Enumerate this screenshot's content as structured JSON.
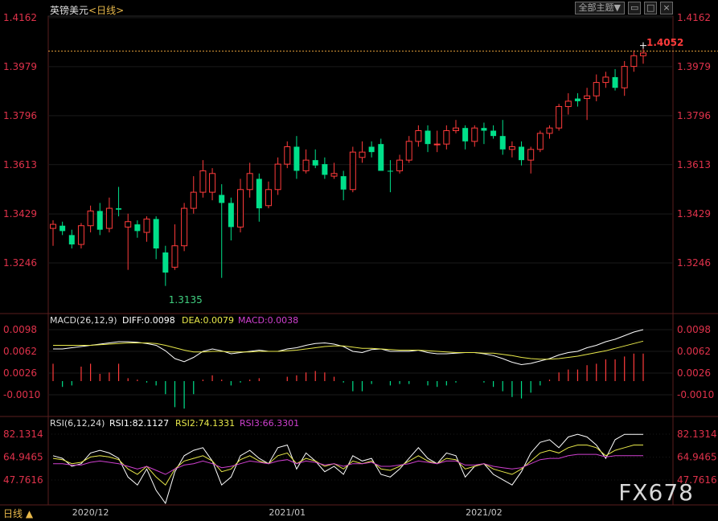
{
  "header": {
    "symbol": "英镑美元",
    "period_link": "<日线>"
  },
  "toolbar": {
    "theme_button": "全部主题▼",
    "icons": [
      "window-restore-icon",
      "window-maximize-icon",
      "close-window-icon"
    ]
  },
  "main_chart": {
    "price_ticks": [
      "1.4162",
      "1.3979",
      "1.3796",
      "1.3613",
      "1.3429",
      "1.3246"
    ],
    "price_tick_values": [
      1.4162,
      1.3979,
      1.3796,
      1.3613,
      1.3429,
      1.3246
    ],
    "last_price": "1.4052",
    "low_label": "1.3135",
    "high_label": "1.4052",
    "candles": [
      {
        "o": 1.339,
        "h": 1.3405,
        "l": 1.331,
        "c": 1.3375,
        "d": "up"
      },
      {
        "o": 1.3385,
        "h": 1.34,
        "l": 1.335,
        "c": 1.3365,
        "d": "down"
      },
      {
        "o": 1.335,
        "h": 1.337,
        "l": 1.33,
        "c": 1.3315,
        "d": "down"
      },
      {
        "o": 1.3315,
        "h": 1.3395,
        "l": 1.33,
        "c": 1.3385,
        "d": "up"
      },
      {
        "o": 1.3385,
        "h": 1.346,
        "l": 1.336,
        "c": 1.344,
        "d": "up"
      },
      {
        "o": 1.344,
        "h": 1.347,
        "l": 1.335,
        "c": 1.337,
        "d": "down"
      },
      {
        "o": 1.3375,
        "h": 1.349,
        "l": 1.336,
        "c": 1.345,
        "d": "up"
      },
      {
        "o": 1.345,
        "h": 1.353,
        "l": 1.342,
        "c": 1.3445,
        "d": "down"
      },
      {
        "o": 1.34,
        "h": 1.343,
        "l": 1.322,
        "c": 1.338,
        "d": "up"
      },
      {
        "o": 1.339,
        "h": 1.3405,
        "l": 1.334,
        "c": 1.3365,
        "d": "down"
      },
      {
        "o": 1.336,
        "h": 1.342,
        "l": 1.3325,
        "c": 1.341,
        "d": "up"
      },
      {
        "o": 1.341,
        "h": 1.342,
        "l": 1.326,
        "c": 1.33,
        "d": "down"
      },
      {
        "o": 1.3285,
        "h": 1.331,
        "l": 1.316,
        "c": 1.321,
        "d": "down"
      },
      {
        "o": 1.323,
        "h": 1.339,
        "l": 1.322,
        "c": 1.331,
        "d": "up"
      },
      {
        "o": 1.331,
        "h": 1.347,
        "l": 1.329,
        "c": 1.345,
        "d": "up"
      },
      {
        "o": 1.345,
        "h": 1.357,
        "l": 1.343,
        "c": 1.351,
        "d": "up"
      },
      {
        "o": 1.351,
        "h": 1.363,
        "l": 1.349,
        "c": 1.359,
        "d": "up"
      },
      {
        "o": 1.358,
        "h": 1.36,
        "l": 1.348,
        "c": 1.351,
        "d": "up"
      },
      {
        "o": 1.35,
        "h": 1.354,
        "l": 1.319,
        "c": 1.347,
        "d": "down"
      },
      {
        "o": 1.347,
        "h": 1.349,
        "l": 1.333,
        "c": 1.338,
        "d": "down"
      },
      {
        "o": 1.338,
        "h": 1.356,
        "l": 1.336,
        "c": 1.352,
        "d": "up"
      },
      {
        "o": 1.352,
        "h": 1.362,
        "l": 1.349,
        "c": 1.358,
        "d": "up"
      },
      {
        "o": 1.356,
        "h": 1.358,
        "l": 1.34,
        "c": 1.345,
        "d": "down"
      },
      {
        "o": 1.346,
        "h": 1.355,
        "l": 1.345,
        "c": 1.352,
        "d": "up"
      },
      {
        "o": 1.352,
        "h": 1.364,
        "l": 1.35,
        "c": 1.3615,
        "d": "up"
      },
      {
        "o": 1.3615,
        "h": 1.37,
        "l": 1.36,
        "c": 1.368,
        "d": "up"
      },
      {
        "o": 1.368,
        "h": 1.372,
        "l": 1.356,
        "c": 1.359,
        "d": "down"
      },
      {
        "o": 1.359,
        "h": 1.367,
        "l": 1.358,
        "c": 1.363,
        "d": "up"
      },
      {
        "o": 1.363,
        "h": 1.367,
        "l": 1.36,
        "c": 1.361,
        "d": "down"
      },
      {
        "o": 1.3615,
        "h": 1.364,
        "l": 1.356,
        "c": 1.3575,
        "d": "down"
      },
      {
        "o": 1.357,
        "h": 1.362,
        "l": 1.356,
        "c": 1.358,
        "d": "up"
      },
      {
        "o": 1.357,
        "h": 1.359,
        "l": 1.348,
        "c": 1.352,
        "d": "down"
      },
      {
        "o": 1.352,
        "h": 1.368,
        "l": 1.351,
        "c": 1.366,
        "d": "up"
      },
      {
        "o": 1.366,
        "h": 1.37,
        "l": 1.362,
        "c": 1.364,
        "d": "up"
      },
      {
        "o": 1.366,
        "h": 1.37,
        "l": 1.364,
        "c": 1.368,
        "d": "down"
      },
      {
        "o": 1.369,
        "h": 1.371,
        "l": 1.359,
        "c": 1.359,
        "d": "down"
      },
      {
        "o": 1.359,
        "h": 1.363,
        "l": 1.351,
        "c": 1.359,
        "d": "down"
      },
      {
        "o": 1.359,
        "h": 1.365,
        "l": 1.358,
        "c": 1.363,
        "d": "up"
      },
      {
        "o": 1.363,
        "h": 1.372,
        "l": 1.362,
        "c": 1.37,
        "d": "up"
      },
      {
        "o": 1.37,
        "h": 1.376,
        "l": 1.368,
        "c": 1.374,
        "d": "up"
      },
      {
        "o": 1.374,
        "h": 1.376,
        "l": 1.366,
        "c": 1.369,
        "d": "down"
      },
      {
        "o": 1.369,
        "h": 1.374,
        "l": 1.366,
        "c": 1.369,
        "d": "up"
      },
      {
        "o": 1.369,
        "h": 1.376,
        "l": 1.367,
        "c": 1.374,
        "d": "up"
      },
      {
        "o": 1.374,
        "h": 1.378,
        "l": 1.373,
        "c": 1.375,
        "d": "up"
      },
      {
        "o": 1.375,
        "h": 1.376,
        "l": 1.367,
        "c": 1.37,
        "d": "down"
      },
      {
        "o": 1.37,
        "h": 1.376,
        "l": 1.368,
        "c": 1.375,
        "d": "up"
      },
      {
        "o": 1.375,
        "h": 1.377,
        "l": 1.369,
        "c": 1.374,
        "d": "down"
      },
      {
        "o": 1.374,
        "h": 1.376,
        "l": 1.371,
        "c": 1.372,
        "d": "down"
      },
      {
        "o": 1.372,
        "h": 1.378,
        "l": 1.365,
        "c": 1.367,
        "d": "down"
      },
      {
        "o": 1.367,
        "h": 1.37,
        "l": 1.364,
        "c": 1.368,
        "d": "up"
      },
      {
        "o": 1.368,
        "h": 1.37,
        "l": 1.361,
        "c": 1.363,
        "d": "down"
      },
      {
        "o": 1.363,
        "h": 1.368,
        "l": 1.358,
        "c": 1.367,
        "d": "up"
      },
      {
        "o": 1.367,
        "h": 1.374,
        "l": 1.366,
        "c": 1.373,
        "d": "up"
      },
      {
        "o": 1.373,
        "h": 1.376,
        "l": 1.371,
        "c": 1.375,
        "d": "up"
      },
      {
        "o": 1.375,
        "h": 1.384,
        "l": 1.374,
        "c": 1.383,
        "d": "up"
      },
      {
        "o": 1.383,
        "h": 1.388,
        "l": 1.38,
        "c": 1.385,
        "d": "up"
      },
      {
        "o": 1.385,
        "h": 1.388,
        "l": 1.383,
        "c": 1.386,
        "d": "down"
      },
      {
        "o": 1.386,
        "h": 1.39,
        "l": 1.378,
        "c": 1.387,
        "d": "up"
      },
      {
        "o": 1.387,
        "h": 1.395,
        "l": 1.385,
        "c": 1.392,
        "d": "up"
      },
      {
        "o": 1.392,
        "h": 1.396,
        "l": 1.39,
        "c": 1.394,
        "d": "up"
      },
      {
        "o": 1.394,
        "h": 1.397,
        "l": 1.389,
        "c": 1.39,
        "d": "down"
      },
      {
        "o": 1.39,
        "h": 1.4,
        "l": 1.387,
        "c": 1.398,
        "d": "up"
      },
      {
        "o": 1.398,
        "h": 1.404,
        "l": 1.396,
        "c": 1.402,
        "d": "up"
      },
      {
        "o": 1.402,
        "h": 1.4052,
        "l": 1.399,
        "c": 1.403,
        "d": "up"
      }
    ]
  },
  "macd": {
    "label": "MACD(26,12,9)",
    "diff_label": "DIFF:0.0098",
    "dea_label": "DEA:0.0079",
    "macd_label": "MACD:0.0038",
    "ticks": [
      "0.0098",
      "0.0062",
      "0.0026",
      "-0.0010"
    ],
    "tick_values": [
      0.0098,
      0.0062,
      0.0026,
      -0.001
    ],
    "diff": [
      0.0066,
      0.0066,
      0.0068,
      0.007,
      0.0072,
      0.0074,
      0.0076,
      0.0078,
      0.0078,
      0.0077,
      0.0075,
      0.0072,
      0.0063,
      0.005,
      0.0045,
      0.0052,
      0.0062,
      0.0066,
      0.0063,
      0.0058,
      0.006,
      0.0062,
      0.0064,
      0.0062,
      0.0062,
      0.0066,
      0.0068,
      0.0072,
      0.0075,
      0.0076,
      0.0074,
      0.007,
      0.0062,
      0.006,
      0.0065,
      0.0066,
      0.0062,
      0.0062,
      0.0062,
      0.0064,
      0.006,
      0.0058,
      0.0058,
      0.0059,
      0.006,
      0.006,
      0.0058,
      0.0055,
      0.005,
      0.0044,
      0.004,
      0.0042,
      0.0046,
      0.005,
      0.0056,
      0.006,
      0.0062,
      0.0068,
      0.0072,
      0.0078,
      0.0082,
      0.0088,
      0.0094,
      0.0098
    ],
    "dea": [
      0.0072,
      0.0072,
      0.0072,
      0.0072,
      0.0072,
      0.0073,
      0.0074,
      0.0075,
      0.0076,
      0.0076,
      0.0076,
      0.0075,
      0.0072,
      0.0068,
      0.0064,
      0.0061,
      0.0061,
      0.0062,
      0.0062,
      0.0061,
      0.0061,
      0.0061,
      0.0062,
      0.0062,
      0.0062,
      0.0063,
      0.0064,
      0.0066,
      0.0068,
      0.007,
      0.0071,
      0.0071,
      0.0069,
      0.0067,
      0.0067,
      0.0066,
      0.0065,
      0.0064,
      0.0064,
      0.0064,
      0.0063,
      0.0062,
      0.0061,
      0.006,
      0.006,
      0.006,
      0.0059,
      0.0059,
      0.0057,
      0.0055,
      0.0052,
      0.005,
      0.0049,
      0.0049,
      0.005,
      0.0052,
      0.0054,
      0.0057,
      0.006,
      0.0063,
      0.0067,
      0.0071,
      0.0075,
      0.0079
    ],
    "hist": [
      0.0024,
      -0.0008,
      -0.0006,
      0.002,
      0.0024,
      0.001,
      0.0012,
      0.0024,
      0.0004,
      0.0002,
      -0.0002,
      -0.0006,
      -0.0018,
      -0.0036,
      -0.0038,
      -0.0018,
      0.0002,
      0.0008,
      0.0002,
      -0.0006,
      -0.0002,
      0.0002,
      0.0004,
      0.0,
      0.0,
      0.0006,
      0.0008,
      0.0012,
      0.0014,
      0.0012,
      0.0006,
      -0.0002,
      -0.0014,
      -0.0014,
      -0.0004,
      0.0,
      -0.0006,
      -0.0004,
      -0.0004,
      0.0,
      -0.0006,
      -0.0008,
      -0.0006,
      -0.0002,
      0.0,
      0.0,
      -0.0002,
      -0.0008,
      -0.0014,
      -0.0022,
      -0.0024,
      -0.0016,
      -0.0006,
      0.0002,
      0.0012,
      0.0016,
      0.0016,
      0.0022,
      0.0024,
      0.003,
      0.003,
      0.0034,
      0.0038,
      0.0038
    ]
  },
  "rsi": {
    "label": "RSI(6,12,24)",
    "rsi1_label": "RSI1:82.1127",
    "rsi2_label": "RSI2:74.1331",
    "rsi3_label": "RSI3:66.3301",
    "ticks": [
      "82.1314",
      "64.9465",
      "47.7616"
    ],
    "tick_values": [
      82.1314,
      64.9465,
      47.7616
    ],
    "rsi1": [
      66,
      64,
      58,
      60,
      68,
      70,
      68,
      64,
      50,
      44,
      56,
      40,
      28,
      54,
      66,
      70,
      72,
      62,
      44,
      50,
      66,
      70,
      64,
      60,
      72,
      74,
      56,
      68,
      62,
      54,
      58,
      52,
      66,
      62,
      64,
      52,
      50,
      56,
      64,
      72,
      64,
      60,
      68,
      66,
      50,
      58,
      60,
      52,
      48,
      44,
      54,
      68,
      76,
      78,
      72,
      80,
      82,
      80,
      74,
      64,
      78,
      82,
      82,
      82
    ],
    "rsi2": [
      64,
      63,
      60,
      61,
      65,
      66,
      65,
      63,
      56,
      52,
      58,
      50,
      44,
      56,
      62,
      64,
      66,
      62,
      54,
      56,
      63,
      66,
      62,
      60,
      66,
      68,
      60,
      64,
      62,
      58,
      60,
      56,
      62,
      60,
      62,
      56,
      55,
      58,
      62,
      66,
      62,
      60,
      64,
      63,
      56,
      58,
      60,
      56,
      54,
      52,
      56,
      62,
      68,
      70,
      68,
      72,
      74,
      74,
      72,
      66,
      70,
      72,
      74,
      74
    ],
    "rsi3": [
      60,
      60,
      59,
      59,
      61,
      62,
      61,
      60,
      58,
      56,
      58,
      55,
      52,
      56,
      59,
      60,
      62,
      60,
      57,
      58,
      60,
      62,
      61,
      60,
      62,
      63,
      60,
      62,
      61,
      59,
      60,
      58,
      60,
      60,
      61,
      58,
      58,
      59,
      60,
      62,
      61,
      60,
      62,
      62,
      59,
      59,
      60,
      58,
      57,
      56,
      57,
      60,
      63,
      64,
      64,
      66,
      67,
      67,
      67,
      65,
      66,
      66,
      66,
      66
    ]
  },
  "x_axis": {
    "labels": [
      {
        "text": "2020/12",
        "index": 4
      },
      {
        "text": "2021/01",
        "index": 25
      },
      {
        "text": "2021/02",
        "index": 46
      }
    ]
  },
  "footer": {
    "period_tag": "日线 ▲",
    "watermark": "FX678"
  },
  "colors": {
    "up": "#ff3b3b",
    "down": "#00e08a",
    "axis_red": "#e0324b",
    "diff": "#ffffff",
    "dea": "#e8e84a",
    "macd": "#d040d0",
    "grid": "#3a3a3a",
    "last_line": "#e8a13a",
    "low_text": "#40d080",
    "high_text": "#ff3b3b"
  }
}
